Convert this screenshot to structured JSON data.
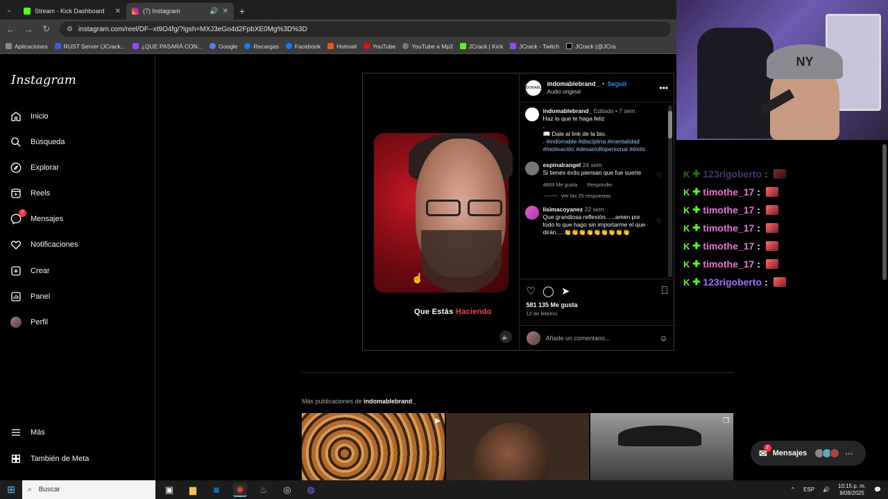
{
  "browser": {
    "tabs": [
      {
        "title": "Stream - Kick Dashboard",
        "active": false
      },
      {
        "title": "(7) Instagram",
        "active": true
      }
    ],
    "url": "instagram.com/reel/DF--xt9O4fg/?igsh=MXJ3eGo4d2FpbXE0Mg%3D%3D",
    "bookmarks": [
      "Aplicaciones",
      "RUST Server (JCrack...",
      "¿QUE PASARÁ CON...",
      "Google",
      "Recargas",
      "Facebook",
      "Hotmail",
      "YouTube",
      "YouTube a Mp3",
      "JCrack | Kick",
      "JCrack - Twitch",
      "JCrack (@JCra"
    ]
  },
  "sidebar": {
    "logo": "Instagram",
    "items": [
      {
        "label": "Inicio",
        "icon": "home-icon"
      },
      {
        "label": "Búsqueda",
        "icon": "search-icon"
      },
      {
        "label": "Explorar",
        "icon": "compass-icon"
      },
      {
        "label": "Reels",
        "icon": "reels-icon"
      },
      {
        "label": "Mensajes",
        "icon": "messenger-icon",
        "badge": "7"
      },
      {
        "label": "Notificaciones",
        "icon": "heart-icon"
      },
      {
        "label": "Crear",
        "icon": "plus-icon"
      },
      {
        "label": "Panel",
        "icon": "panel-icon"
      },
      {
        "label": "Perfil",
        "icon": "avatar"
      }
    ],
    "bottom": [
      {
        "label": "Más",
        "icon": "menu-icon"
      },
      {
        "label": "También de Meta",
        "icon": "meta-icon"
      }
    ]
  },
  "post": {
    "username": "indomablebrand_",
    "follow": "Seguir",
    "separator": "•",
    "audio": "Audio original",
    "video_caption": "Que Estás",
    "video_caption_red": "Haciendo",
    "caption": {
      "user": "indomablebrand_",
      "meta": "Editado • 7 sem",
      "line1": "Haz lo que te haga feliz",
      "line2": ".",
      "line3": "📖 Dale al link de la bio.",
      "tags": ". #indomable #disciplina #mentalidad #motivación #desarrollopersonal #éxito"
    },
    "comments": [
      {
        "user": "espinalrangel",
        "time": "24 sem",
        "text": "Si tienes éxito piensan que fue suerte",
        "likes": "4669 Me gusta",
        "reply": "Responder",
        "replies": "Ver las 25 respuestas"
      },
      {
        "user": "lisimacoyanez",
        "time": "22 sem",
        "text": "Que grandiosa reflexión......amen por todo lo que hago sin importarme el que dirán.....👏👏👏👏👏👏👏👏👏"
      }
    ],
    "likes": "581 135 Me gusta",
    "date": "12 de febrero",
    "add_comment_placeholder": "Añade un comentario..."
  },
  "more_posts": {
    "label": "Más publicaciones de",
    "user": "indomablebrand_"
  },
  "messages_pill": {
    "label": "Mensajes",
    "badge": "7"
  },
  "chat": [
    {
      "user": "123rigoberto",
      "faded": true,
      "color": "purple"
    },
    {
      "user": "timothe_17",
      "faded": false,
      "color": "pink"
    },
    {
      "user": "timothe_17",
      "faded": false,
      "color": "pink"
    },
    {
      "user": "timothe_17",
      "faded": false,
      "color": "pink"
    },
    {
      "user": "timothe_17",
      "faded": false,
      "color": "pink"
    },
    {
      "user": "timothe_17",
      "faded": false,
      "color": "pink"
    },
    {
      "user": "123rigoberto",
      "faded": false,
      "color": "purple"
    }
  ],
  "taskbar": {
    "search": "Buscar",
    "lang": "ESP",
    "time": "10:15 p. m.",
    "date": "8/08/2025"
  },
  "colors": {
    "accent": "#0095f6",
    "kick": "#53fc18",
    "badge": "#ff3040"
  }
}
